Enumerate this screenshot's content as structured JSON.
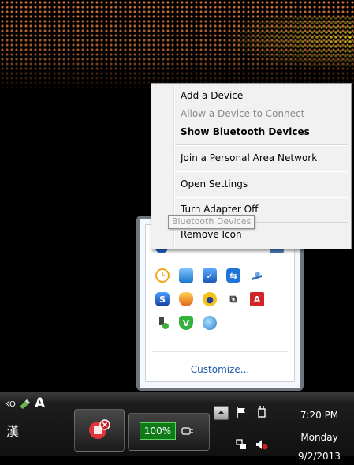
{
  "context_menu": {
    "items": [
      {
        "label": "Add a Device",
        "state": "normal"
      },
      {
        "label": "Allow a Device to Connect",
        "state": "disabled"
      },
      {
        "label": "Show Bluetooth Devices",
        "state": "default"
      },
      {
        "label": "Join a Personal Area Network",
        "state": "normal"
      },
      {
        "label": "Open Settings",
        "state": "normal"
      },
      {
        "label": "Turn Adapter Off",
        "state": "normal"
      },
      {
        "label": "Remove Icon",
        "state": "normal"
      }
    ]
  },
  "tooltip": {
    "text": "Bluetooth Devices"
  },
  "tray_overflow": {
    "customize_label": "Customize...",
    "icons": [
      "clock-icon",
      "monitor-icon",
      "check-chart-icon",
      "chat-icon",
      "printer-icon",
      "shield-s-icon",
      "shield-orange-icon",
      "paw-icon",
      "windows-icon",
      "pdf-icon",
      "usb-plug-icon",
      "vshield-icon",
      "globe-icon"
    ]
  },
  "taskbar": {
    "lang_ko": "KO",
    "lang_a": "A",
    "lang_han": "漢",
    "battery_label": "100%",
    "clock": {
      "time": "7:20 PM",
      "day": "Monday",
      "date": "9/2/2013"
    }
  },
  "colors": {
    "menu_bg": "#f1f1f1",
    "link": "#1e5aa8",
    "battery_green": "#0f7a17"
  }
}
